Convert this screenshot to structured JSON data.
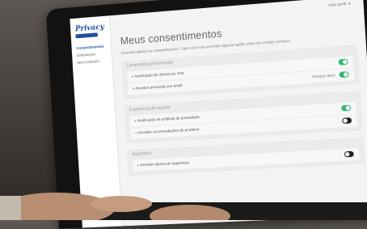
{
  "user_menu": {
    "label": "Abrir perfil"
  },
  "sidebar": {
    "logo": "Privacy",
    "items": [
      {
        "label": "Consentimentos",
        "active": true
      },
      {
        "label": "Solicitações",
        "active": false
      },
      {
        "label": "Meu Cadastro",
        "active": false
      }
    ]
  },
  "main": {
    "title": "Meus consentimentos",
    "description": "Gerencie abaixo os consentimentos. Caso você não encontre alguma opção entre em contato conosco."
  },
  "sections": [
    {
      "title": "Campanhas promocionais",
      "items": [
        {
          "label": "Notificação de ofertas por sms",
          "status": "",
          "toggle": "on"
        },
        {
          "label": "Receber promoção por email",
          "status": "Sempre ativo",
          "toggle": "on"
        }
      ]
    },
    {
      "title": "Experiência de usuário",
      "items": [
        {
          "label": "Notificação de políticas de privacidade",
          "status": "",
          "toggle": "on"
        },
        {
          "label": "Receber recomendações de produtos",
          "status": "",
          "toggle": "off"
        }
      ]
    },
    {
      "title": "Segurança",
      "items": [
        {
          "label": "Receber alertas de segurança",
          "status": "",
          "toggle": "off"
        }
      ]
    }
  ],
  "colors": {
    "accent": "#1f4fa0",
    "toggle_on": "#2eb872",
    "toggle_off": "#222222"
  }
}
